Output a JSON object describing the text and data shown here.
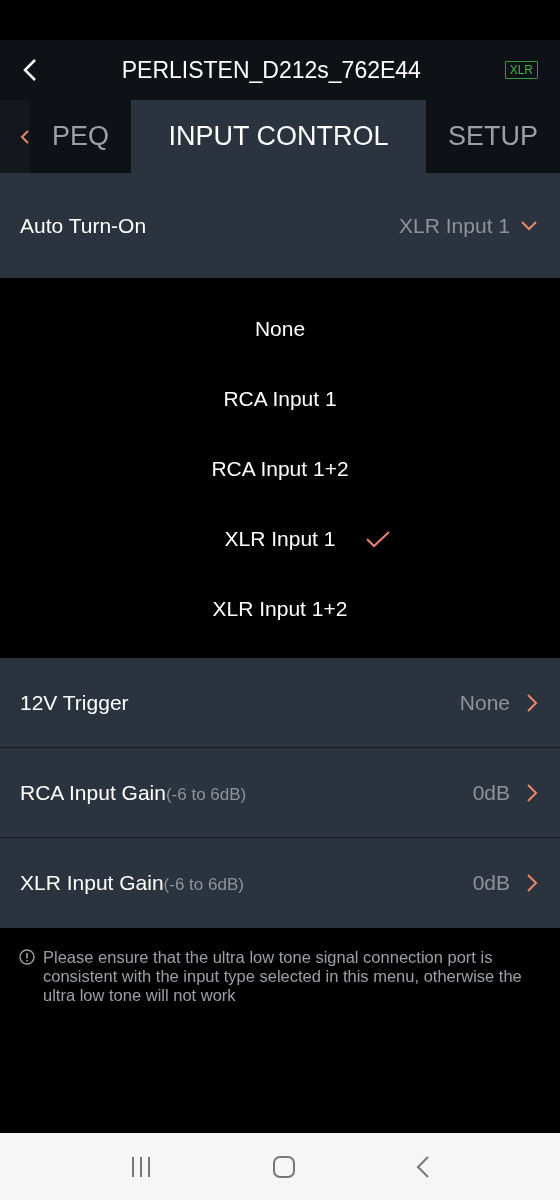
{
  "header": {
    "title": "PERLISTEN_D212s_762E44",
    "badge": "XLR"
  },
  "tabs": [
    {
      "label": "PEQ",
      "selected": false
    },
    {
      "label": "INPUT CONTROL",
      "selected": true
    },
    {
      "label": "SETUP",
      "selected": false
    }
  ],
  "auto_turn_on": {
    "label": "Auto Turn-On",
    "value": "XLR Input 1",
    "expanded": true,
    "options": [
      {
        "label": "None",
        "selected": false
      },
      {
        "label": "RCA Input 1",
        "selected": false
      },
      {
        "label": "RCA Input 1+2",
        "selected": false
      },
      {
        "label": "XLR Input 1",
        "selected": true
      },
      {
        "label": "XLR Input 1+2",
        "selected": false
      }
    ]
  },
  "settings": [
    {
      "label": "12V Trigger",
      "value": "None"
    },
    {
      "label": "RCA Input Gain",
      "hint": "(-6 to 6dB)",
      "value": "0dB"
    },
    {
      "label": "XLR Input Gain",
      "hint": "(-6 to 6dB)",
      "value": "0dB"
    }
  ],
  "notice": "Please ensure that the ultra low tone signal connection port is consistent with the input type selected in this menu, otherwise the ultra low tone will not work"
}
